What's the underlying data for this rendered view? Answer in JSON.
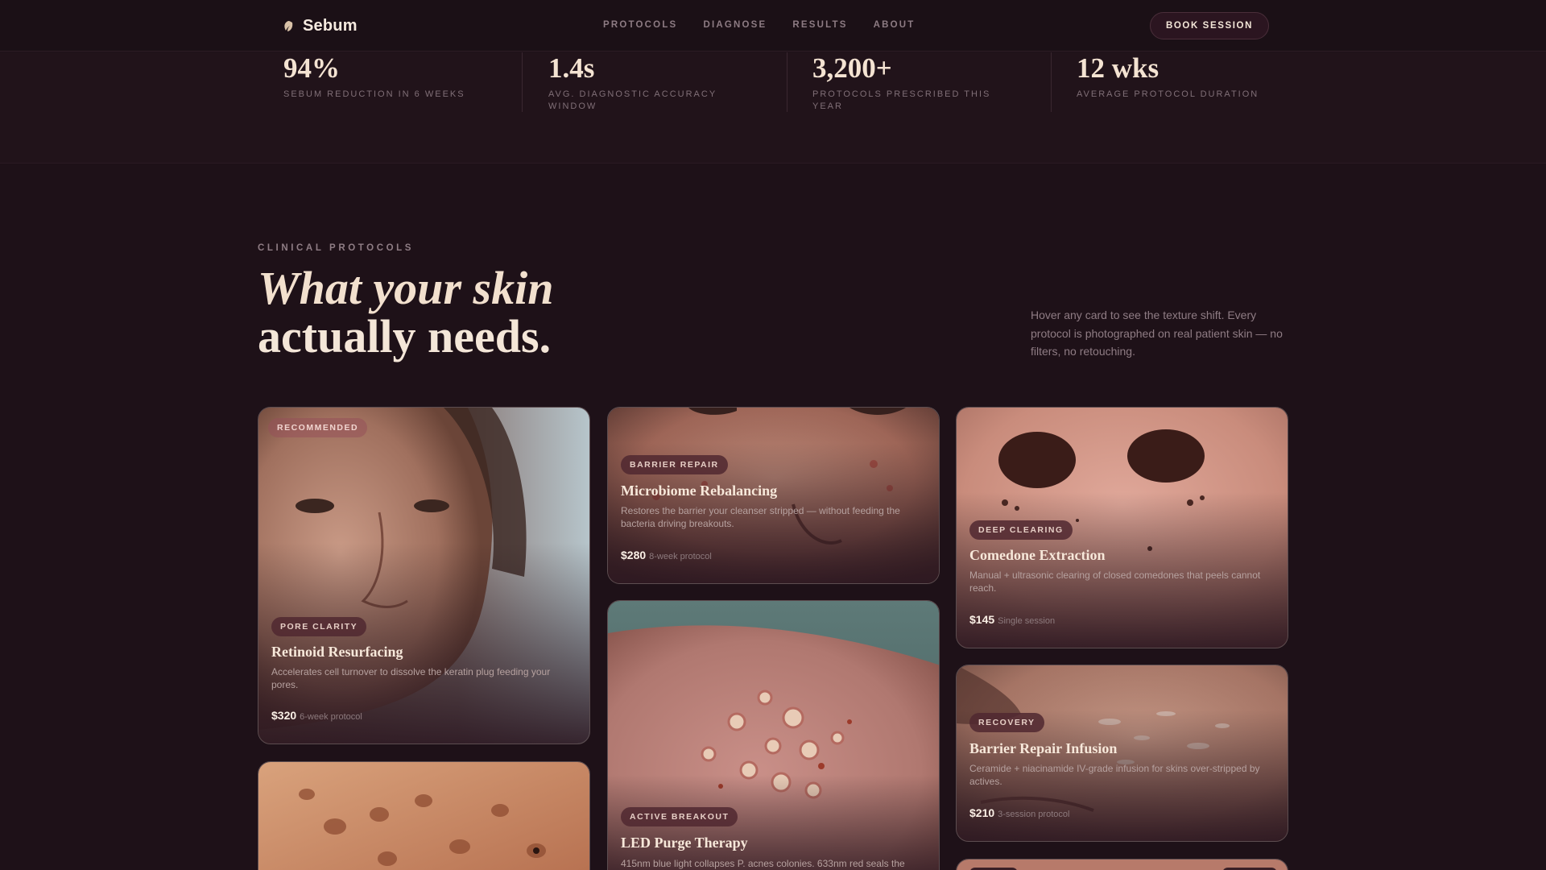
{
  "nav": {
    "brand": "Sebum",
    "links": [
      "PROTOCOLS",
      "DIAGNOSE",
      "RESULTS",
      "ABOUT"
    ],
    "cta": "BOOK SESSION"
  },
  "stats": [
    {
      "value": "94%",
      "label": "SEBUM REDUCTION IN 6 WEEKS"
    },
    {
      "value": "1.4s",
      "label": "AVG. DIAGNOSTIC ACCURACY WINDOW"
    },
    {
      "value": "3,200+",
      "label": "PROTOCOLS PRESCRIBED THIS YEAR"
    },
    {
      "value": "12 wks",
      "label": "AVERAGE PROTOCOL DURATION"
    }
  ],
  "section": {
    "eyebrow": "CLINICAL PROTOCOLS",
    "headline_line1": "What your skin",
    "headline_line2": "actually needs.",
    "intro": "Hover any card to see the texture shift. Every protocol is photographed on real patient skin — no filters, no retouching."
  },
  "cards": [
    {
      "top_badge": "RECOMMENDED",
      "tag": "PORE CLARITY",
      "title": "Retinoid Resurfacing",
      "description": "Accelerates cell turnover to dissolve the keratin plug feeding your pores.",
      "price": "$320",
      "duration": "6-week protocol"
    },
    {
      "tag": "BARRIER REPAIR",
      "title": "Microbiome Rebalancing",
      "description": "Restores the barrier your cleanser stripped — without feeding the bacteria driving breakouts.",
      "price": "$280",
      "duration": "8-week protocol"
    },
    {
      "tag": "DEEP CLEARING",
      "title": "Comedone Extraction",
      "description": "Manual + ultrasonic clearing of closed comedones that peels cannot reach.",
      "price": "$145",
      "duration": "Single session"
    },
    {
      "tag": "ACTIVE BREAKOUT",
      "title": "LED Purge Therapy",
      "description": "415nm blue light collapses P. acnes colonies. 633nm red seals the"
    },
    {
      "tag": "RECOVERY",
      "title": "Barrier Repair Infusion",
      "description": "Ceramide + niacinamide IV-grade infusion for skins over-stripped by actives.",
      "price": "$210",
      "duration": "3-session protocol"
    }
  ]
}
